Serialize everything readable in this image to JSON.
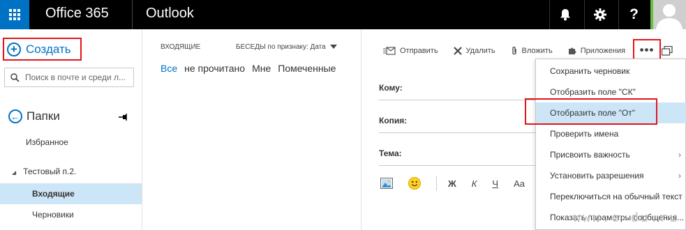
{
  "topbar": {
    "brand": "Office 365",
    "app_name": "Outlook",
    "help_label": "?"
  },
  "leftnav": {
    "create_label": "Создать",
    "search_placeholder": "Поиск в почте и среди л...",
    "folders_label": "Папки",
    "favorites_label": "Избранное",
    "account_label": "Тестовый п.2.",
    "inbox_label": "Входящие",
    "drafts_label": "Черновики"
  },
  "msglist": {
    "header": "ВХОДЯЩИЕ",
    "sort_label": "БЕСЕДЫ по признаку: Дата",
    "filters": [
      "Все",
      "не прочитано",
      "Мне",
      "Помеченные"
    ]
  },
  "compose": {
    "send_label": "Отправить",
    "delete_label": "Удалить",
    "attach_label": "Вложить",
    "apps_label": "Приложения",
    "more_label": "•••",
    "to_label": "Кому:",
    "cc_label": "Копия:",
    "subject_label": "Тема:",
    "fmt_bold": "Ж",
    "fmt_italic": "К",
    "fmt_underline": "Ч",
    "fmt_font": "Aa"
  },
  "menu": {
    "items": [
      "Сохранить черновик",
      "Отобразить поле \"СК\"",
      "Отобразить поле \"От\"",
      "Проверить имена",
      "Присвоить важность",
      "Установить разрешения",
      "Переключиться на обычный текст",
      "Показать параметры сообщения..."
    ],
    "submenu_arrow": "›"
  },
  "watermark": "www.e-du.ru",
  "colors": {
    "accent": "#0072c6",
    "topbar": "#000000",
    "highlight": "#cde6f7",
    "annotation_red": "#e2141a"
  }
}
